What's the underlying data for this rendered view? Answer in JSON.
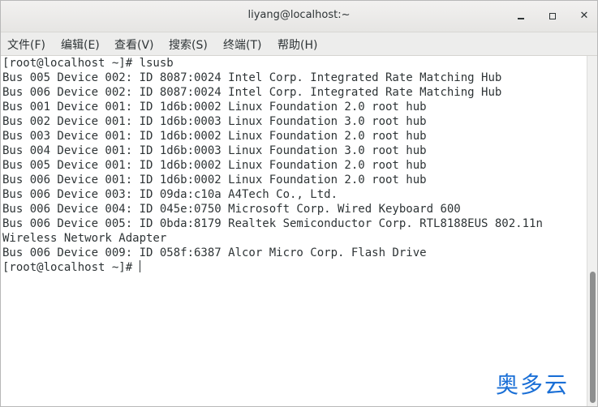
{
  "window": {
    "title": "liyang@localhost:~"
  },
  "menubar": {
    "items": [
      {
        "label": "文件(F)"
      },
      {
        "label": "编辑(E)"
      },
      {
        "label": "查看(V)"
      },
      {
        "label": "搜索(S)"
      },
      {
        "label": "终端(T)"
      },
      {
        "label": "帮助(H)"
      }
    ]
  },
  "terminal": {
    "lines": [
      "[root@localhost ~]# lsusb",
      "Bus 005 Device 002: ID 8087:0024 Intel Corp. Integrated Rate Matching Hub",
      "Bus 006 Device 002: ID 8087:0024 Intel Corp. Integrated Rate Matching Hub",
      "Bus 001 Device 001: ID 1d6b:0002 Linux Foundation 2.0 root hub",
      "Bus 002 Device 001: ID 1d6b:0003 Linux Foundation 3.0 root hub",
      "Bus 003 Device 001: ID 1d6b:0002 Linux Foundation 2.0 root hub",
      "Bus 004 Device 001: ID 1d6b:0003 Linux Foundation 3.0 root hub",
      "Bus 005 Device 001: ID 1d6b:0002 Linux Foundation 2.0 root hub",
      "Bus 006 Device 001: ID 1d6b:0002 Linux Foundation 2.0 root hub",
      "Bus 006 Device 003: ID 09da:c10a A4Tech Co., Ltd.",
      "Bus 006 Device 004: ID 045e:0750 Microsoft Corp. Wired Keyboard 600",
      "Bus 006 Device 005: ID 0bda:8179 Realtek Semiconductor Corp. RTL8188EUS 802.11n",
      "Wireless Network Adapter",
      "Bus 006 Device 009: ID 058f:6387 Alcor Micro Corp. Flash Drive",
      "[root@localhost ~]# "
    ]
  },
  "watermark": {
    "text": "奥多云",
    "color": "#1a6fd6"
  },
  "colors": {
    "text": "#2e3436",
    "background": "#ffffff",
    "scroll_thumb": "#8e8f8f"
  }
}
